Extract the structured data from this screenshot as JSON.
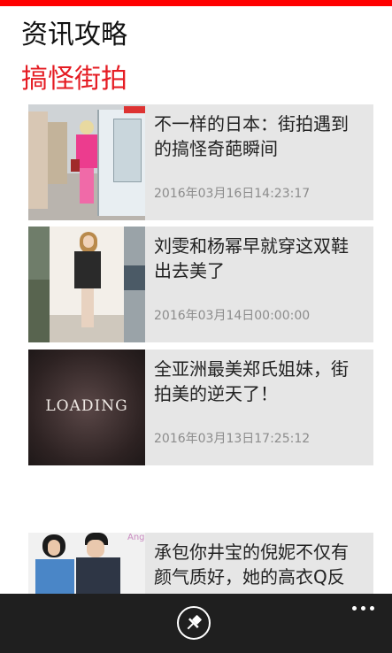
{
  "app": {
    "title": "资讯攻略",
    "section_title": "搞怪街拍"
  },
  "articles": [
    {
      "title": "不一样的日本：街拍遇到的搞怪奇葩瞬间",
      "date": "2016年03月16日14:23:17",
      "thumbnail": "store-aisle-photo"
    },
    {
      "title": "刘雯和杨幂早就穿这双鞋出去美了",
      "date": "2016年03月14日00:00:00",
      "thumbnail": "street-style-photo"
    },
    {
      "title": "全亚洲最美郑氏姐妹，街拍美的逆天了！",
      "date": "2016年03月13日17:25:12",
      "thumbnail_text": "LOADING"
    },
    {
      "title": "承包你井宝的倪妮不仅有颜气质好，她的高衣Q反",
      "thumbnail": "couple-photo",
      "thumbnail_text": "Ang"
    }
  ],
  "appbar": {
    "pin_icon": "pin-icon",
    "more_icon": "more-icon"
  },
  "colors": {
    "accent": "#ff0000",
    "section_title": "#e51c23",
    "card_bg": "#e6e6e6",
    "appbar_bg": "#1f1f1f"
  }
}
